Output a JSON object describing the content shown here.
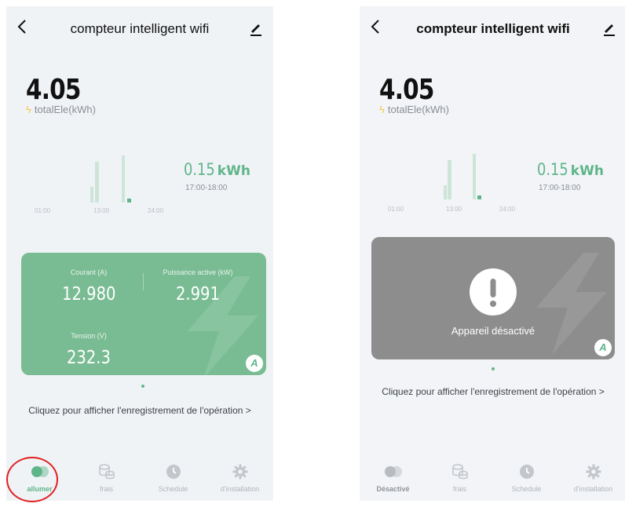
{
  "colors": {
    "accent": "#5fb58a",
    "card_active": "#79bc93",
    "card_disabled": "#8d8d8d",
    "annotation": "#e02020"
  },
  "left": {
    "header": {
      "title": "compteur intelligent wifi",
      "back_icon": "chevron-left-icon",
      "edit_icon": "pencil-icon"
    },
    "total": {
      "value": "4.05",
      "label": "totalEle(kWh)"
    },
    "chart": {
      "value": "0.15",
      "unit": "kWh",
      "range": "17:00-18:00",
      "ticks": [
        "01:00",
        "13:00",
        "24:00"
      ]
    },
    "card": {
      "current_label": "Courant (A)",
      "current_value": "12.980",
      "power_label": "Puissance active (kW)",
      "power_value": "2.991",
      "voltage_label": "Tension (V)",
      "voltage_value": "232.3",
      "badge": "A"
    },
    "link": "Cliquez pour afficher l'enregistrement de l'opération >",
    "tabs": [
      {
        "label": "allumer",
        "icon": "toggle-icon"
      },
      {
        "label": "frais",
        "icon": "coins-icon"
      },
      {
        "label": "Schedule",
        "icon": "clock-icon"
      },
      {
        "label": "d'installation",
        "icon": "gear-icon"
      }
    ]
  },
  "right": {
    "header": {
      "title": "compteur intelligent wifi",
      "back_icon": "chevron-left-icon",
      "edit_icon": "pencil-icon"
    },
    "total": {
      "value": "4.05",
      "label": "totalEle(kWh)"
    },
    "chart": {
      "value": "0.15",
      "unit": "kWh",
      "range": "17:00-18:00",
      "ticks": [
        "01:00",
        "13:00",
        "24:00"
      ]
    },
    "disabled": {
      "text": "Appareil désactivé",
      "badge": "A"
    },
    "link": "Cliquez pour afficher l'enregistrement de l'opération >",
    "tabs": [
      {
        "label": "Désactivé",
        "icon": "toggle-icon"
      },
      {
        "label": "frais",
        "icon": "coins-icon"
      },
      {
        "label": "Schedule",
        "icon": "clock-icon"
      },
      {
        "label": "d'installation",
        "icon": "gear-icon"
      }
    ]
  }
}
